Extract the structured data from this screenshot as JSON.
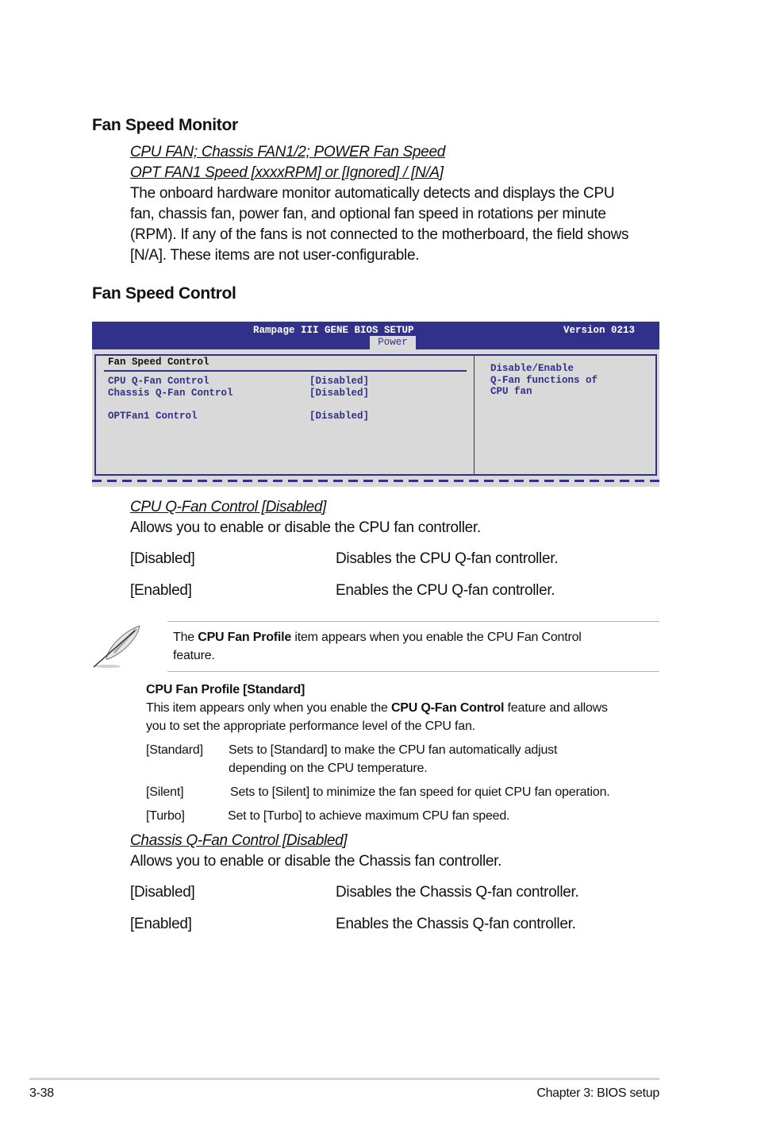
{
  "fan_speed_monitor": {
    "heading": "Fan Speed Monitor",
    "item_title_line1": "CPU FAN; Chassis FAN1/2; POWER Fan Speed",
    "item_title_line2": "OPT FAN1 Speed [xxxxRPM] or [Ignored] / [N/A]",
    "description_lines": [
      "The onboard hardware monitor automatically detects and displays the CPU",
      "fan, chassis fan, power fan, and optional fan speed in rotations per minute",
      "(RPM). If any of the fans is not connected to the motherboard, the field shows",
      "[N/A]. These items are not user-configurable."
    ]
  },
  "fan_speed_control": {
    "heading": "Fan Speed Control"
  },
  "bios": {
    "title": "Rampage III GENE BIOS SETUP",
    "version": "Version 0213",
    "active_tab": "Power",
    "section_title": "Fan Speed Control",
    "items": [
      {
        "label": "CPU Q-Fan Control",
        "value": "[Disabled]"
      },
      {
        "label": "Chassis Q-Fan Control",
        "value": "[Disabled]"
      },
      {
        "label": "OPTFan1 Control",
        "value": "[Disabled]"
      }
    ],
    "help_lines": [
      "Disable/Enable",
      "Q-Fan functions of",
      "CPU fan"
    ],
    "colors": {
      "header": "#31318c",
      "panel": "#d9d9d9",
      "text": "#31318c"
    }
  },
  "cpu_qfan": {
    "title": "CPU Q-Fan Control [Disabled]",
    "description": "Allows you to enable or disable the CPU fan controller.",
    "options": [
      {
        "name": "[Disabled]",
        "desc": "Disables the CPU Q-fan controller."
      },
      {
        "name": "[Enabled]",
        "desc": "Enables the CPU Q-fan controller."
      }
    ]
  },
  "note": {
    "icon": "feather-pen-icon",
    "prefix": "The ",
    "bold": "CPU Fan Profile",
    "suffix_line1": " item appears when you enable the CPU Fan Control",
    "line2": "feature."
  },
  "cpu_fan_profile": {
    "title": "CPU Fan Profile [Standard]",
    "desc_prefix": "This item appears only when you enable the ",
    "desc_bold": "CPU Q-Fan Control",
    "desc_suffix": " feature and allows",
    "desc_line2": "you to set the appropriate performance level of the CPU fan.",
    "options": [
      {
        "name": "[Standard]",
        "desc_line1": "Sets to [Standard] to make the CPU fan automatically adjust",
        "desc_line2": "depending on the CPU temperature."
      },
      {
        "name": "[Silent]",
        "desc_line1": "Sets to [Silent] to minimize the fan speed for quiet CPU fan operation."
      },
      {
        "name": "[Turbo]",
        "desc_line1": "Set to [Turbo] to achieve maximum CPU fan speed."
      }
    ]
  },
  "chassis_qfan": {
    "title": "Chassis Q-Fan Control [Disabled]",
    "description": "Allows you to enable or disable the Chassis fan controller.",
    "options": [
      {
        "name": "[Disabled]",
        "desc": "Disables the Chassis Q-fan controller."
      },
      {
        "name": "[Enabled]",
        "desc": "Enables the Chassis Q-fan controller."
      }
    ]
  },
  "footer": {
    "page_number": "3-38",
    "chapter": "Chapter 3: BIOS setup"
  }
}
